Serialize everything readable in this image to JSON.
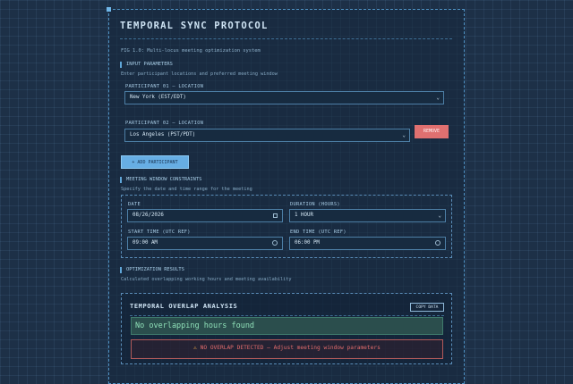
{
  "app": {
    "title": "TEMPORAL SYNC PROTOCOL",
    "version": "FIG 1.0: Multi-locus meeting optimization system"
  },
  "input": {
    "heading": "INPUT PARAMETERS",
    "description": "Enter participant locations and preferred meeting window",
    "participants": [
      {
        "label": "PARTICIPANT 01 — LOCATION",
        "value": "New York (EST/EDT)"
      },
      {
        "label": "PARTICIPANT 02 — LOCATION",
        "value": "Los Angeles (PST/PDT)"
      }
    ],
    "remove_label": "REMOVE",
    "add_label": "+ ADD PARTICIPANT"
  },
  "constraints": {
    "heading": "MEETING WINDOW CONSTRAINTS",
    "description": "Specify the date and time range for the meeting",
    "date_label": "DATE",
    "date_value": "08/26/2026",
    "duration_label": "DURATION (HOURS)",
    "duration_value": "1 HOUR",
    "start_label": "START TIME (UTC REF)",
    "start_value": "09:00 AM",
    "end_label": "END TIME (UTC REF)",
    "end_value": "06:00 PM"
  },
  "results": {
    "heading": "OPTIMIZATION RESULTS",
    "description": "Calculated overlapping working hours and meeting availability",
    "analysis_title": "TEMPORAL OVERLAP ANALYSIS",
    "copy_label": "COPY DATA",
    "no_overlap": "No overlapping hours found",
    "warning_icon": "⚠",
    "warning": "NO OVERLAP DETECTED — Adjust meeting window parameters"
  }
}
